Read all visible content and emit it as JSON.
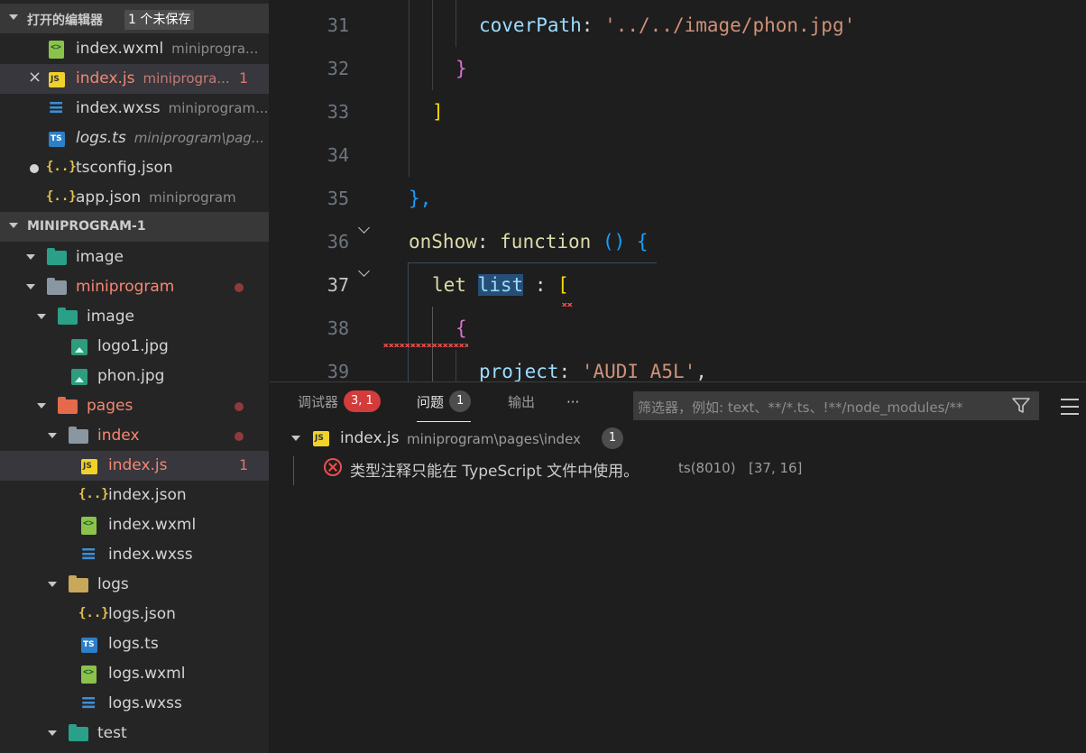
{
  "sidebar": {
    "open_editors": {
      "title": "打开的编辑器",
      "unsaved_badge": "1 个未保存",
      "items": [
        {
          "name": "index.wxml",
          "desc": "miniprogra...",
          "icon": "wxml-file-icon"
        },
        {
          "name": "index.js",
          "desc": "miniprogra...",
          "count": "1",
          "icon": "js-file-icon",
          "error": true,
          "close": "×"
        },
        {
          "name": "index.wxss",
          "desc": "miniprogram...",
          "icon": "wxss-file-icon"
        },
        {
          "name": "logs.ts",
          "desc": "miniprogram\\pag...",
          "icon": "ts-file-icon"
        },
        {
          "name": "tsconfig.json",
          "desc": "",
          "icon": "json-file-icon",
          "unsaved": true
        },
        {
          "name": "app.json",
          "desc": "miniprogram",
          "icon": "json-file-icon"
        }
      ]
    },
    "explorer": {
      "title": "MINIPROGRAM-1",
      "items": [
        {
          "name": "image",
          "icon": "image-folder-icon"
        },
        {
          "name": "miniprogram",
          "icon": "folder-icon",
          "error": true
        },
        {
          "name": "image",
          "icon": "image-folder-icon"
        },
        {
          "name": "logo1.jpg",
          "icon": "image-file-icon"
        },
        {
          "name": "phon.jpg",
          "icon": "image-file-icon"
        },
        {
          "name": "pages",
          "icon": "pages-folder-icon",
          "error": true
        },
        {
          "name": "index",
          "icon": "folder-icon",
          "error": true
        },
        {
          "name": "index.js",
          "icon": "js-file-icon",
          "error": true,
          "count": "1"
        },
        {
          "name": "index.json",
          "icon": "json-file-icon"
        },
        {
          "name": "index.wxml",
          "icon": "wxml-file-icon"
        },
        {
          "name": "index.wxss",
          "icon": "wxss-file-icon"
        },
        {
          "name": "logs",
          "icon": "logs-folder-icon"
        },
        {
          "name": "logs.json",
          "icon": "json-file-icon"
        },
        {
          "name": "logs.ts",
          "icon": "ts-file-icon"
        },
        {
          "name": "logs.wxml",
          "icon": "wxml-file-icon"
        },
        {
          "name": "logs.wxss",
          "icon": "wxss-file-icon"
        },
        {
          "name": "test",
          "icon": "test-folder-icon"
        }
      ]
    }
  },
  "editor": {
    "line_numbers": [
      "31",
      "32",
      "33",
      "34",
      "35",
      "36",
      "37",
      "38",
      "39"
    ],
    "current_line": "37",
    "code": {
      "l31_prop": "coverPath",
      "l31_colon": ": ",
      "l31_str": "'../../image/phon.jpg'",
      "l32": "}",
      "l33": "]",
      "l35": "},",
      "l36_key": "onShow",
      "l36_colon": ": ",
      "l36_fn": "function",
      "l36_parens": " () ",
      "l36_brace": "{",
      "l37_let": "let",
      "l37_var": "list",
      "l37_colon": " : ",
      "l37_bracket": "[",
      "l38": "{",
      "l39_prop": "project",
      "l39_colon": ": ",
      "l39_str": "'AUDI A5L'",
      "l39_comma": ","
    }
  },
  "panel": {
    "tabs": [
      {
        "label": "调试器",
        "badge": "3, 1"
      },
      {
        "label": "问题",
        "badge": "1"
      },
      {
        "label": "输出"
      },
      {
        "label": "···"
      }
    ],
    "filter_placeholder": "筛选器，例如: text、**/*.ts、!**/node_modules/**",
    "problems": {
      "file": "index.js",
      "path": "miniprogram\\pages\\index",
      "count": "1",
      "message": "类型注释只能在 TypeScript 文件中使用。",
      "source": "ts(8010)",
      "position": "[37, 16]"
    }
  },
  "colors": {
    "error": "#f14c4c",
    "sidebar_bg": "#252526",
    "editor_bg": "#1e1e1e",
    "badge_red": "#d43c3c"
  }
}
